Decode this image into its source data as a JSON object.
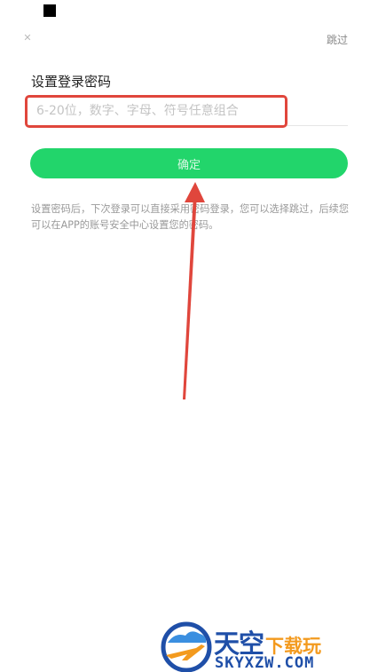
{
  "header": {
    "close_icon": "close-icon",
    "skip_label": "跳过"
  },
  "form": {
    "title": "设置登录密码",
    "password_placeholder": "6-20位，数字、字母、符号任意组合",
    "password_value": "",
    "confirm_label": "确定"
  },
  "hint": {
    "text": "设置密码后，下次登录可以直接采用密码登录，您可以选择跳过，后续您可以在APP的账号安全中心设置您的密码。"
  },
  "annotation": {
    "highlight_color": "#e0463c",
    "arrow_color": "#e0463c"
  },
  "watermark": {
    "logo_icon": "skyxzw-logo-icon",
    "main": "天空",
    "sub": "下载玩",
    "url": "SKYXZW.COM"
  },
  "colors": {
    "accent": "#22d56b",
    "watermark_blue": "#1f4fa8",
    "watermark_orange": "#f39a1e"
  }
}
